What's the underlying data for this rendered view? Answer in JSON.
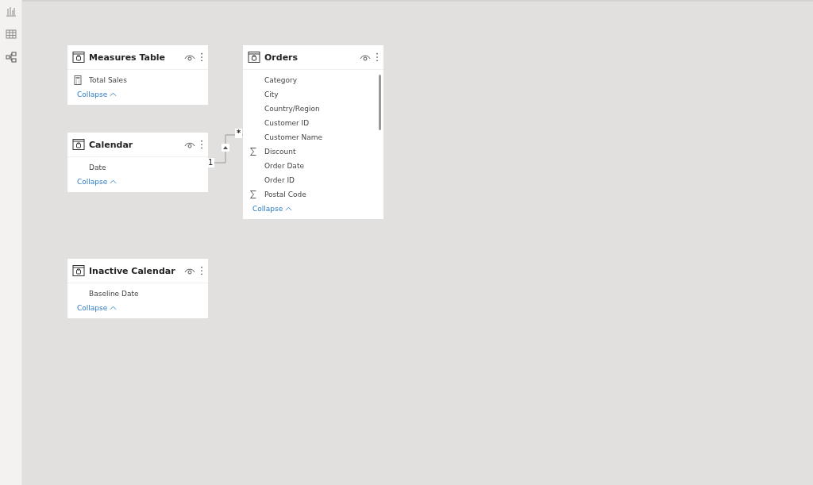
{
  "sidebar": {
    "items": [
      {
        "kind": "report"
      },
      {
        "kind": "data"
      },
      {
        "kind": "model"
      }
    ]
  },
  "tables": [
    {
      "name": "Measures Table",
      "fields": [
        {
          "name": "Total Sales",
          "kind": "measure"
        }
      ],
      "footer": "Collapse"
    },
    {
      "name": "Calendar",
      "fields": [
        {
          "name": "Date",
          "kind": "column"
        }
      ],
      "footer": "Collapse"
    },
    {
      "name": "Inactive Calendar",
      "fields": [
        {
          "name": "Baseline Date",
          "kind": "column"
        }
      ],
      "footer": "Collapse"
    },
    {
      "name": "Orders",
      "fields": [
        {
          "name": "Category",
          "kind": "column"
        },
        {
          "name": "City",
          "kind": "column"
        },
        {
          "name": "Country/Region",
          "kind": "column"
        },
        {
          "name": "Customer ID",
          "kind": "column"
        },
        {
          "name": "Customer Name",
          "kind": "column"
        },
        {
          "name": "Discount",
          "kind": "sum"
        },
        {
          "name": "Order Date",
          "kind": "column"
        },
        {
          "name": "Order ID",
          "kind": "column"
        },
        {
          "name": "Postal Code",
          "kind": "sum"
        }
      ],
      "footer": "Collapse"
    }
  ],
  "relationship": {
    "from_label": "1",
    "to_label": "*"
  }
}
